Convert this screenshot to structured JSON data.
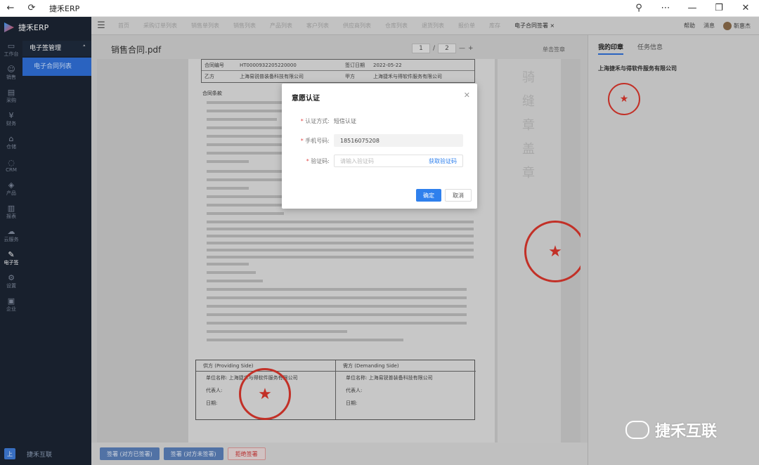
{
  "window": {
    "title": "捷禾ERP"
  },
  "sidebar": {
    "brand": "捷禾ERP",
    "rail": [
      {
        "label": "工作台",
        "icon": "desktop-icon"
      },
      {
        "label": "销售",
        "icon": "person-icon"
      },
      {
        "label": "采购",
        "icon": "cart-icon"
      },
      {
        "label": "财务",
        "icon": "money-icon"
      },
      {
        "label": "仓储",
        "icon": "box-icon"
      },
      {
        "label": "CRM",
        "icon": "crm-icon"
      },
      {
        "label": "产品",
        "icon": "cube-icon"
      },
      {
        "label": "报表",
        "icon": "chart-icon"
      },
      {
        "label": "云服务",
        "icon": "cloud-icon"
      },
      {
        "label": "电子签",
        "icon": "sign-icon"
      },
      {
        "label": "设置",
        "icon": "gear-icon"
      },
      {
        "label": "企业",
        "icon": "company-icon"
      }
    ],
    "group": "电子签管理",
    "active_item": "电子合同列表",
    "footer_user": "捷禾互联",
    "footer_avatar": "上"
  },
  "topnav": {
    "tabs": [
      "首页",
      "采购订单列表",
      "销售单列表",
      "销售列表",
      "产品列表",
      "客户列表",
      "供应商列表",
      "仓库列表",
      "退货列表",
      "报价单",
      "库存",
      "电子合同签署"
    ],
    "active_tab": "电子合同签署",
    "right": {
      "help": "帮助",
      "message": "消息",
      "user": "靳惠杰"
    }
  },
  "doc": {
    "title": "销售合同.pdf",
    "page_current": "1",
    "page_total": "2",
    "sign_single": "单击签章",
    "table_rows": [
      [
        "合同编号",
        "HT0000932205220000",
        "签订日期",
        "2022-05-22"
      ],
      [
        "乙方",
        "上海易锐普装备科技有限公司",
        "甲方",
        "上海捷禾与得软件服务有限公司"
      ]
    ],
    "heading": "合同条款",
    "provider_title": "供方 (Providing Side)",
    "demander_title": "需方 (Demanding Side)",
    "provider_name": "单位名称: 上海捷禾与得软件服务有限公司",
    "demander_name": "单位名称: 上海易锐普装备科技有限公司",
    "rep": "代表人:",
    "date": "日期:",
    "strip_chars": [
      "骑",
      "缝",
      "章",
      "盖",
      "章"
    ]
  },
  "rpanel": {
    "tabs": [
      "我的印章",
      "任务信息"
    ],
    "active_tab": "我的印章",
    "company": "上海捷禾与得软件服务有限公司"
  },
  "bottombar": {
    "btn1": "签署 (对方已签署)",
    "btn2": "签署 (对方未签署)",
    "btn3": "拒绝签署"
  },
  "modal": {
    "title": "意愿认证",
    "method_label": "认证方式:",
    "method_value": "短信认证",
    "phone_label": "手机号码:",
    "phone_value": "18516075208",
    "code_label": "验证码:",
    "code_placeholder": "请输入验证码",
    "get_code": "获取验证码",
    "ok": "确定",
    "cancel": "取消"
  },
  "watermark": "捷禾互联",
  "colors": {
    "primary": "#2f80ed",
    "stamp": "#d9362c",
    "sidebar": "#1b2433"
  }
}
